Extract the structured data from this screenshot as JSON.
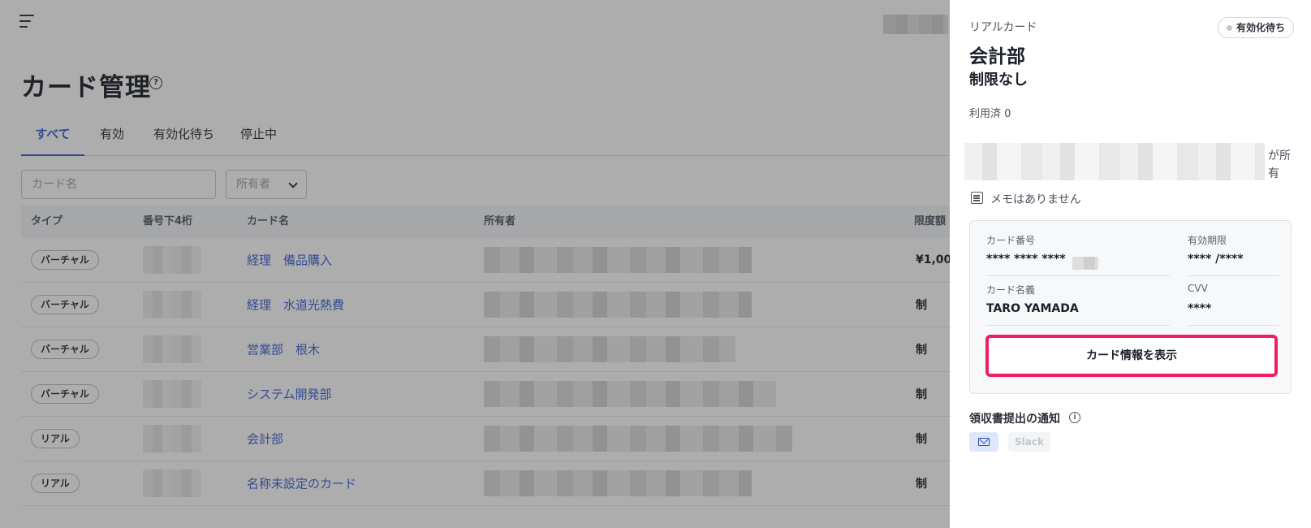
{
  "page": {
    "title": "カード管理",
    "tabs": [
      {
        "label": "すべて",
        "active": true
      },
      {
        "label": "有効",
        "active": false
      },
      {
        "label": "有効化待ち",
        "active": false
      },
      {
        "label": "停止中",
        "active": false
      }
    ],
    "search_placeholder": "カード名",
    "owner_filter_label": "所有者",
    "table": {
      "headers": [
        "タイプ",
        "番号下4桁",
        "カード名",
        "所有者",
        "限度額"
      ],
      "rows": [
        {
          "type": "バーチャル",
          "name": "経理　備品購入",
          "limit": "¥1,00"
        },
        {
          "type": "バーチャル",
          "name": "経理　水道光熱費",
          "limit": "制"
        },
        {
          "type": "バーチャル",
          "name": "営業部　根木",
          "limit": "制"
        },
        {
          "type": "バーチャル",
          "name": "システム開発部",
          "limit": "制"
        },
        {
          "type": "リアル",
          "name": "会計部",
          "limit": "制"
        },
        {
          "type": "リアル",
          "name": "名称未設定のカード",
          "limit": "制"
        }
      ]
    }
  },
  "panel": {
    "kind": "リアルカード",
    "status": "有効化待ち",
    "name": "会計部",
    "limit": "制限なし",
    "used": "利用済 0",
    "owner_suffix": "が所有",
    "memo": "メモはありません",
    "card": {
      "number_label": "カード番号",
      "number_value": "**** **** ****",
      "expiry_label": "有効期限",
      "expiry_value": "**** /****",
      "holder_label": "カード名義",
      "holder_value": "TARO YAMADA",
      "cvv_label": "CVV",
      "cvv_value": "****",
      "show_button": "カード情報を表示"
    },
    "notify_title": "領収書提出の通知",
    "notify_slack": "Slack"
  },
  "colors": {
    "accent": "#3b62d6",
    "highlight": "#ee1e62",
    "overlay": "rgba(40,40,40,0.38)"
  }
}
